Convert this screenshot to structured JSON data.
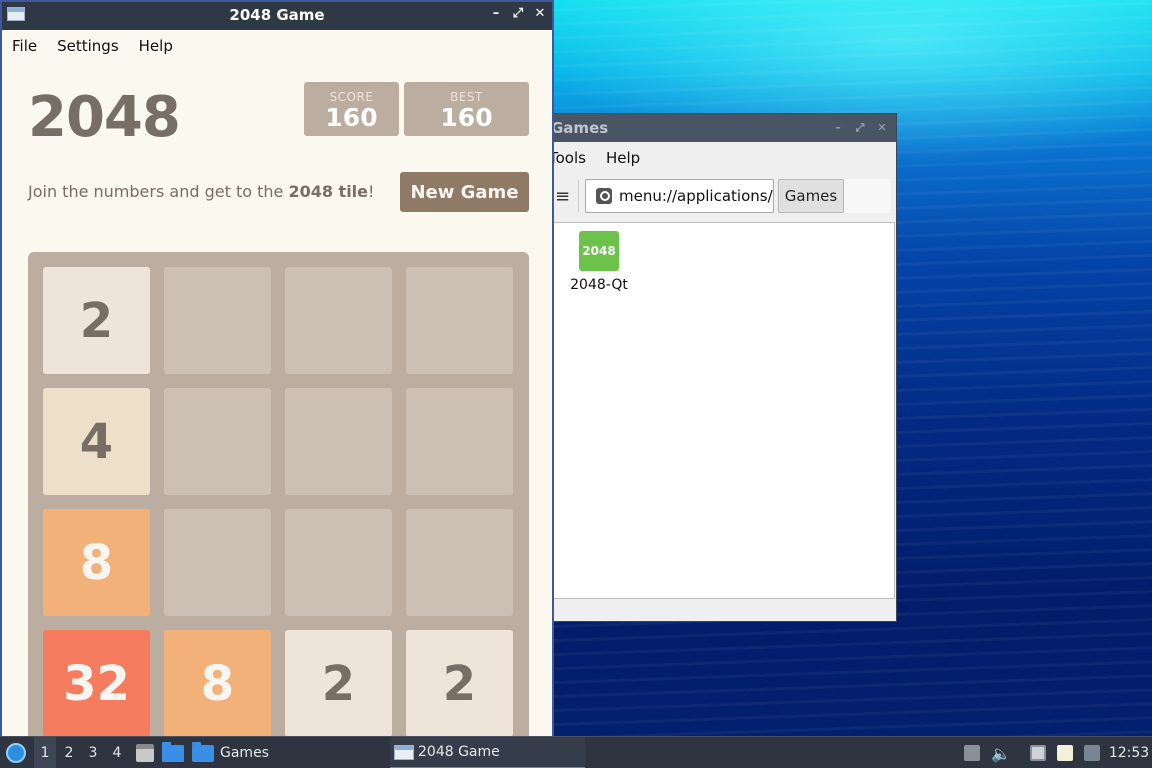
{
  "game_window": {
    "title": "2048 Game",
    "menu": [
      "File",
      "Settings",
      "Help"
    ],
    "heading": "2048",
    "score_label": "SCORE",
    "score": "160",
    "best_label": "BEST",
    "best": "160",
    "intro_prefix": "Join the numbers and get to the ",
    "intro_bold": "2048 tile",
    "intro_suffix": "!",
    "new_game": "New Game",
    "board": [
      [
        2,
        null,
        null,
        null
      ],
      [
        4,
        null,
        null,
        null
      ],
      [
        8,
        null,
        null,
        null
      ],
      [
        32,
        8,
        2,
        2
      ]
    ]
  },
  "games_window": {
    "title": "Games",
    "menu": [
      "Tools",
      "Help"
    ],
    "path": "menu://applications/",
    "crumb": "Games",
    "items": [
      {
        "icon_text": "2048",
        "label": "2048-Qt",
        "icon_color": "#6cc24a"
      }
    ]
  },
  "taskbar": {
    "workspaces": [
      "1",
      "2",
      "3",
      "4"
    ],
    "tasks": [
      {
        "label": "Games",
        "icon": "folder-icon"
      },
      {
        "label": "2048 Game",
        "icon": "window-icon"
      }
    ],
    "clock": "12:53"
  },
  "colors": {
    "tile_2": "#eee4da",
    "tile_4": "#ede0c8",
    "tile_8": "#f2b179",
    "tile_32": "#f67c5f",
    "board": "#bbada0",
    "accent": "#8f7a66"
  }
}
